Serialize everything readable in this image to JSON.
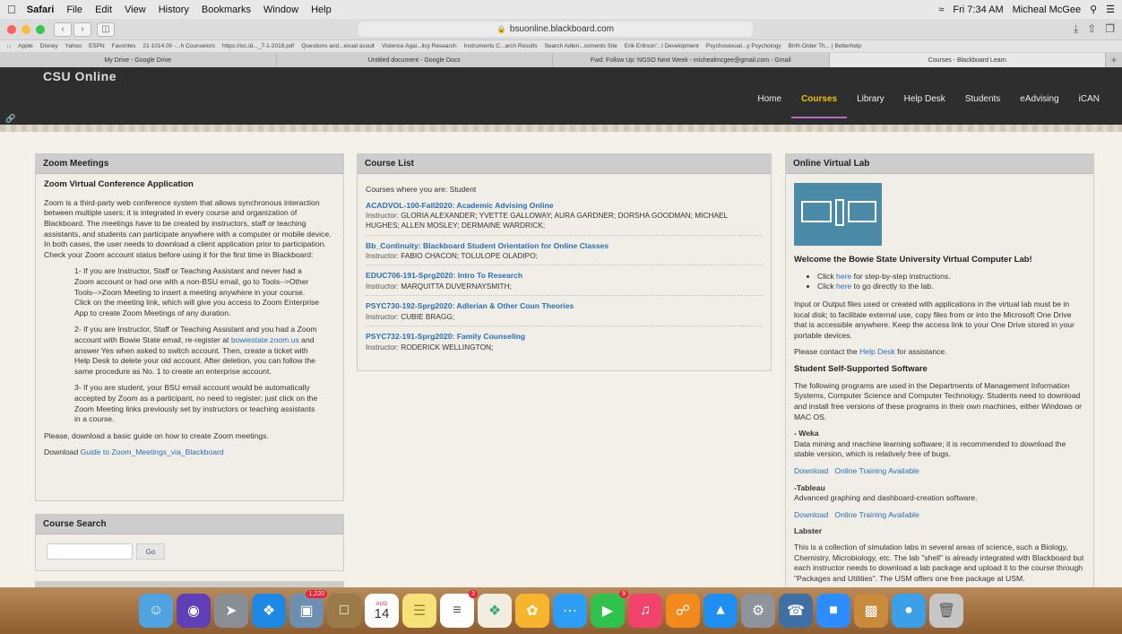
{
  "menubar": {
    "app": "Safari",
    "items": [
      "File",
      "Edit",
      "View",
      "History",
      "Bookmarks",
      "Window",
      "Help"
    ],
    "clock": "Fri 7:34 AM",
    "user": "Micheal McGee"
  },
  "toolbar": {
    "url": "bsuonline.blackboard.com"
  },
  "bookmarks": [
    "Apple",
    "Disney",
    "Yahoo",
    "ESPN",
    "Favorites",
    "21-1014.00 -...h Counselors",
    "https://isc.id..._7-1-2018.pdf",
    "Questions and...exual assult",
    "Violence Agai...licy Research",
    "Instruments C...arch Results",
    "Search Adleri...ssments Site",
    "Erik Erikson'...l Development",
    "Psychosexual...y Psychology",
    "Birth Order Th... | Betterhelp"
  ],
  "tabs": [
    "My Drive - Google Drive",
    "Untitled document - Google Docs",
    "Fwd: Follow Up: NGSO Next Week - michealmcgee@gmail.com - Gmail",
    "Courses - Blackboard Learn"
  ],
  "site": {
    "logo": "CSU Online",
    "nav": [
      "Home",
      "Courses",
      "Library",
      "Help Desk",
      "Students",
      "eAdvising",
      "iCAN"
    ]
  },
  "zoom": {
    "title": "Zoom Meetings",
    "subtitle": "Zoom Virtual Conference Application",
    "intro": "Zoom is a third-party web conference system that allows synchronous interaction between multiple users; it is integrated in every course and organization of Blackboard. The meetings have to be created by instructors, staff or teaching assistants, and students can participate anywhere with a computer or mobile device. In both cases, the user needs to download a client application prior to participation. Check your Zoom account status before using it for the first time in Blackboard:",
    "p1": "1- If you are Instructor, Staff or Teaching Assistant and never had a Zoom account or had one with a non-BSU email, go to Tools-->Other Tools-->Zoom Meeting to insert a meeting anywhere in your course.  Click on the meeting link, which will give you access to Zoom Enterprise App to create Zoom Meetings of any duration.",
    "p2a": "2- If you are Instructor, Staff or Teaching Assistant and you had a Zoom account with Bowie State email, re-register at",
    "p2link": "bowiestate.zoom.us",
    "p2b": "and answer Yes when asked to switch account. Then, create a ticket with Help Desk to delete your old account. After deletion, you can follow the same procedure as No. 1 to create an enterprise account.",
    "p3": "3- If you are student, your BSU email account would be automatically accepted by Zoom as a participant, no need to register; just click on the Zoom Meeting links previously set by instructors or teaching assistants in a course.",
    "guide_note": "Please, download a basic guide on how to create Zoom meetings.",
    "download_label": "Download",
    "download_link": "Guide to Zoom_Meetings_via_Blackboard"
  },
  "search": {
    "title": "Course Search",
    "go": "Go"
  },
  "courses": {
    "title": "Course List",
    "role_note": "Courses where you are: Student",
    "instructor_label": "Instructor:",
    "items": [
      {
        "name": "ACADVOL-100-Fall2020: Academic Advising Online",
        "instructors": "GLORIA ALEXANDER;  YVETTE GALLOWAY;  AURA GARDNER;  DORSHA GOODMAN;  MICHAEL HUGHES;  ALLEN MOSLEY;  DERMAINE WARDRICK;"
      },
      {
        "name": "Bb_Continuity: Blackboard Student Orientation for Online Classes",
        "instructors": "FABIO CHACON;  TOLULOPE OLADIPO;"
      },
      {
        "name": "EDUC706-191-Sprg2020: Intro To Research",
        "instructors": "MARQUITTA DUVERNAYSMITH;"
      },
      {
        "name": "PSYC730-192-Sprg2020: Adlerian & Other Coun Theories",
        "instructors": "CUBIE BRAGG;"
      },
      {
        "name": "PSYC732-191-Sprg2020: Family Counseling",
        "instructors": "RODERICK WELLINGTON;"
      }
    ]
  },
  "lab": {
    "title": "Online Virtual Lab",
    "welcome": "Welcome the Bowie State University Virtual Computer Lab!",
    "b1_pre": "Click",
    "b1_link": "here",
    "b1_post": "for step-by-step instructions.",
    "b2_pre": "Click",
    "b2_link": "here",
    "b2_post": "to go directly to the lab.",
    "p1": "Input or Output files used or created with applications in the virtual lab must be in local disk; to facilitate external use, copy files from or into the Microsoft One Drive that is accessible anywhere. Keep the access link to your One Drive stored in your portable devices.",
    "contact_pre": "Please contact the",
    "contact_link": "Help Desk",
    "contact_post": "for assistance.",
    "sss_title": "Student Self-Supported Software",
    "sss_text": "The following programs are used in the Departments of Management Information Systems, Computer Science and Computer Technology. Students need to download and install free versions of these programs in their own machines, either Windows or MAC OS.",
    "weka_title": "- Weka",
    "weka_text": "Data mining and machine learning software; it is recommended to download the stable version, which is relatively free of bugs.",
    "download": "Download",
    "training": "Online Training Available",
    "tableau_title": "-Tableau",
    "tableau_text": "Advanced graphing and dashboard-creation software.",
    "labster_title": "Labster",
    "labster_text": "This is a collection of simulation labs in several areas of science, such a Biology, Chemistry, Microbiology, etc. The lab \"shell\" is already integrated with Blackboard but each instructor needs to download a lab package and upload it to the course through \"Packages and Utilities\". The USM offers one free package at USM."
  },
  "dock": {
    "badges": {
      "photos": "1,220",
      "calendar_month": "AUG",
      "calendar_day": "14",
      "reminders": "3",
      "facetime": "9"
    }
  },
  "colors": {
    "header": "#2e2e2e",
    "accent": "#f0c000",
    "link": "#2a6fb5"
  }
}
